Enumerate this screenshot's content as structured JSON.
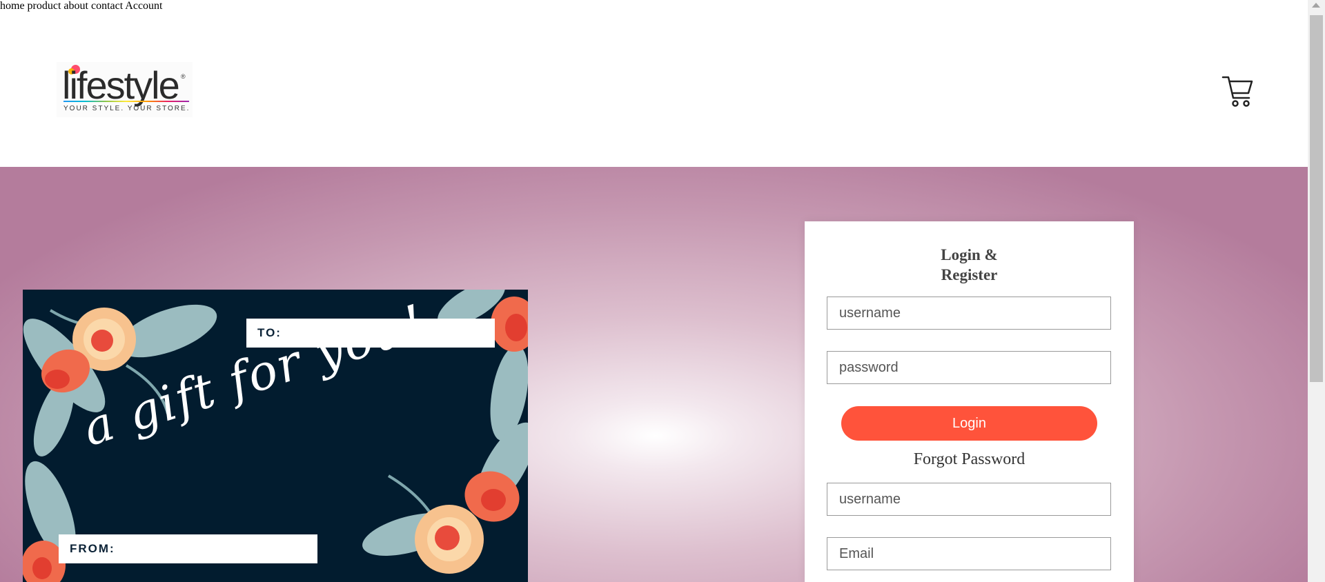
{
  "stray_text": "\"",
  "brand": {
    "name": "lifestyle",
    "registered": "®",
    "tagline": "YOUR STYLE. YOUR STORE."
  },
  "nav": {
    "items": [
      {
        "label": "home"
      },
      {
        "label": "product"
      },
      {
        "label": "about"
      },
      {
        "label": "contact"
      },
      {
        "label": "Account"
      }
    ],
    "cart_icon": "shopping-cart-icon"
  },
  "gift_card": {
    "to_label": "TO:",
    "from_label": "FROM:",
    "message": "a gift for you!"
  },
  "panel": {
    "title_line1": "Login &",
    "title_line2": "Register",
    "login_username_placeholder": "username",
    "login_password_placeholder": "password",
    "login_button": "Login",
    "forgot_password": "Forgot Password",
    "register_username_placeholder": "username",
    "register_email_placeholder": "Email"
  },
  "colors": {
    "accent": "#ff533b",
    "card_background": "#021c2f",
    "hero_outer": "#b47c9c"
  }
}
